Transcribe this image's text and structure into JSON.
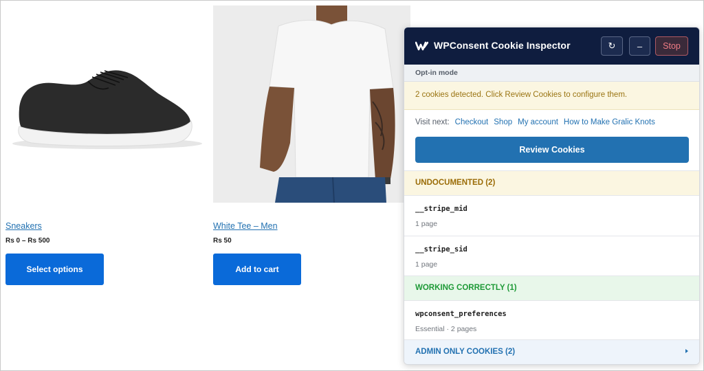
{
  "products": [
    {
      "title": "Sneakers",
      "price": "Rs 0 – Rs 500",
      "button": "Select options"
    },
    {
      "title": "White Tee – Men",
      "price": "Rs 50",
      "button": "Add to cart"
    }
  ],
  "inspector": {
    "title": "WPConsent Cookie Inspector",
    "refresh_symbol": "↻",
    "minimize_symbol": "–",
    "stop_label": "Stop",
    "mode": "Opt-in mode",
    "notice": "2 cookies detected. Click Review Cookies to configure them.",
    "visit_label": "Visit next:",
    "visit_links": [
      "Checkout",
      "Shop",
      "My account",
      "How to Make Gralic Knots"
    ],
    "review_button": "Review Cookies",
    "sections": {
      "undocumented": {
        "label": "UNDOCUMENTED (2)",
        "cookies": [
          {
            "name": "__stripe_mid",
            "meta": "1 page"
          },
          {
            "name": "__stripe_sid",
            "meta": "1 page"
          }
        ]
      },
      "working": {
        "label": "WORKING CORRECTLY (1)",
        "cookies": [
          {
            "name": "wpconsent_preferences",
            "meta": "Essential · 2 pages"
          }
        ]
      },
      "admin": {
        "label": "ADMIN ONLY COOKIES (2)"
      }
    }
  },
  "icons": {
    "logo": "wpconsent-logo-icon",
    "refresh": "refresh-icon",
    "minimize": "minimize-icon",
    "expand": "caret-right-icon"
  },
  "colors": {
    "header_bg": "#0f1d3f",
    "primary": "#2271b1",
    "shop_button": "#0a6ad9",
    "undocumented": "#9a6b06",
    "working": "#1e9a37",
    "stop": "#f07c85"
  }
}
